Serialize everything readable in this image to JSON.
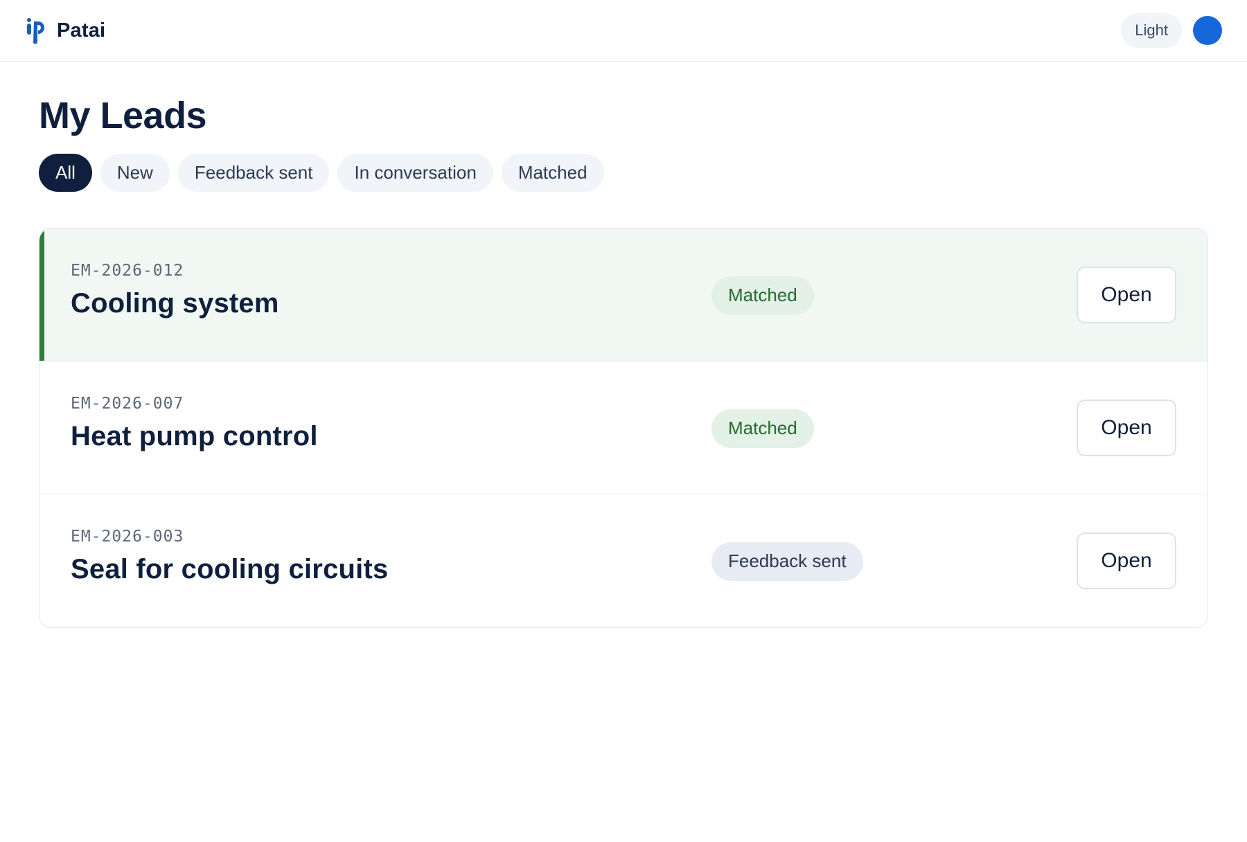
{
  "header": {
    "brand_name": "Patai",
    "logo_icon": "patai-logo-icon",
    "theme_toggle_label": "Light",
    "accent_color": "#1667d9"
  },
  "page": {
    "title": "My Leads"
  },
  "filters": [
    {
      "label": "All",
      "active": true
    },
    {
      "label": "New",
      "active": false
    },
    {
      "label": "Feedback sent",
      "active": false
    },
    {
      "label": "In conversation",
      "active": false
    },
    {
      "label": "Matched",
      "active": false
    }
  ],
  "leads": [
    {
      "id": "EM-2026-012",
      "title": "Cooling system",
      "status": "Matched",
      "status_type": "matched",
      "action": "Open",
      "highlighted": true
    },
    {
      "id": "EM-2026-007",
      "title": "Heat pump control",
      "status": "Matched",
      "status_type": "matched",
      "action": "Open",
      "highlighted": false
    },
    {
      "id": "EM-2026-003",
      "title": "Seal for cooling circuits",
      "status": "Feedback sent",
      "status_type": "feedback",
      "action": "Open",
      "highlighted": false
    }
  ],
  "colors": {
    "primary_dark": "#0f1f3d",
    "matched_bg": "#e3f1e6",
    "matched_text": "#256b32",
    "highlight_bar": "#2e7d3b",
    "feedback_bg": "#e6ebf4"
  }
}
